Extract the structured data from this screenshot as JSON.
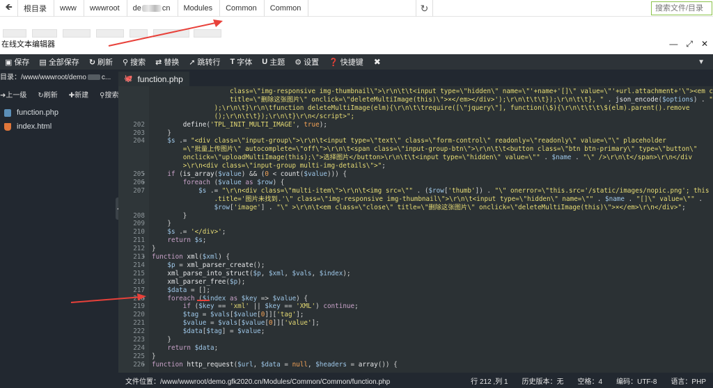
{
  "addressbar": {
    "crumbs": [
      "根目录",
      "www",
      "wwwroot",
      "de",
      "cn",
      "Modules",
      "Common",
      "Common"
    ],
    "search_placeholder": "搜索文件/目录"
  },
  "window": {
    "title": "在线文本编辑器"
  },
  "toolbar": {
    "items": [
      {
        "icon": "save-icon",
        "label": "保存"
      },
      {
        "icon": "save-all-icon",
        "label": "全部保存"
      },
      {
        "icon": "refresh-icon",
        "label": "刷新"
      },
      {
        "icon": "search-icon",
        "label": "搜索"
      },
      {
        "icon": "replace-icon",
        "label": "替换"
      },
      {
        "icon": "goto-line-icon",
        "label": "跳转行"
      },
      {
        "icon": "font-icon",
        "label": "字体"
      },
      {
        "icon": "theme-icon",
        "label": "主题"
      },
      {
        "icon": "gear-icon",
        "label": "设置"
      },
      {
        "icon": "help-icon",
        "label": "快捷键"
      }
    ]
  },
  "sidebar": {
    "path": "目录：/www/wwwroot/demo",
    "path_suffix": "c...",
    "actions": [
      "上一级",
      "刷新",
      "新建",
      "搜索"
    ],
    "files": [
      {
        "name": "function.php",
        "type": "php"
      },
      {
        "name": "index.html",
        "type": "html"
      }
    ]
  },
  "tab": {
    "name": "function.php"
  },
  "code": {
    "lines": [
      {
        "n": "",
        "fold": "",
        "html": "&nbsp;&nbsp;&nbsp;&nbsp;&nbsp;&nbsp;&nbsp;&nbsp;&nbsp;&nbsp;&nbsp;&nbsp;&nbsp;&nbsp;&nbsp;&nbsp;&nbsp;&nbsp;&nbsp;&nbsp;<span class=\"st\">class=\\\"img-responsive img-thumbnail\\\"&gt;\\r\\n\\t\\t&lt;input type=\\\"hidden\\\" name=\\\"'+name+'[]\\\" value=\\\"'+url.attachment+'\\\"&gt;&lt;em class=\\\"close\\\"</span>"
      },
      {
        "n": "",
        "fold": "",
        "html": "&nbsp;&nbsp;&nbsp;&nbsp;&nbsp;&nbsp;&nbsp;&nbsp;&nbsp;&nbsp;&nbsp;&nbsp;&nbsp;&nbsp;&nbsp;&nbsp;&nbsp;&nbsp;&nbsp;&nbsp;<span class=\"st\">title=\\\"删除这张图片\\\" onclick=\\\"deleteMultiImage(this)\\\"&gt;×&lt;/em&gt;&lt;/div&gt;');\\r\\n\\t\\t\\t});\\r\\n\\t\\t}, \"</span> . <span class=\"fn\">json_encode</span>(<span class=\"va\">$options</span>) . <span class=\"st\">\"</span>"
      },
      {
        "n": "",
        "fold": "",
        "html": "&nbsp;&nbsp;&nbsp;&nbsp;&nbsp;&nbsp;&nbsp;&nbsp;&nbsp;&nbsp;&nbsp;&nbsp;&nbsp;&nbsp;&nbsp;&nbsp;<span class=\"st\">);\\r\\n\\t}\\r\\n\\tfunction deleteMultiImage(elm){\\r\\n\\t\\trequire([\\\"jquery\\\"], function(\\$){\\r\\n\\t\\t\\t\\$(elm).parent().remove</span>"
      },
      {
        "n": "",
        "fold": "",
        "html": "&nbsp;&nbsp;&nbsp;&nbsp;&nbsp;&nbsp;&nbsp;&nbsp;&nbsp;&nbsp;&nbsp;&nbsp;&nbsp;&nbsp;&nbsp;&nbsp;<span class=\"st\">();\\r\\n\\t\\t});\\r\\n\\t}\\r\\n&lt;/script&gt;\";</span>"
      },
      {
        "n": "202",
        "fold": "",
        "html": "&nbsp;&nbsp;&nbsp;&nbsp;&nbsp;&nbsp;&nbsp;&nbsp;<span class=\"fn\">define</span>(<span class=\"st\">'TPL_INIT_MULTI_IMAGE'</span>, <span class=\"bi\">true</span>);"
      },
      {
        "n": "203",
        "fold": "",
        "html": "&nbsp;&nbsp;&nbsp;&nbsp;}"
      },
      {
        "n": "204",
        "fold": "",
        "html": "&nbsp;&nbsp;&nbsp;&nbsp;<span class=\"va\">$s</span> .= <span class=\"st\">\"&lt;div class=\\\"input-group\\\"&gt;\\r\\n\\t&lt;input type=\\\"text\\\" class=\\\"form-control\\\" readonly=\\\"readonly\\\" value=\\\"\\\" placeholder</span>"
      },
      {
        "n": "",
        "fold": "",
        "html": "&nbsp;&nbsp;&nbsp;&nbsp;&nbsp;&nbsp;&nbsp;&nbsp;<span class=\"st\">=\\\"批量上传图片\\\" autocomplete=\\\"off\\\"&gt;\\r\\n\\t&lt;span class=\\\"input-group-btn\\\"&gt;\\r\\n\\t\\t&lt;button class=\\\"btn btn-primary\\\" type=\\\"button\\\"</span>"
      },
      {
        "n": "",
        "fold": "",
        "html": "&nbsp;&nbsp;&nbsp;&nbsp;&nbsp;&nbsp;&nbsp;&nbsp;<span class=\"st\">onclick=\\\"uploadMultiImage(this);\\\"&gt;选择图片&lt;/button&gt;\\r\\n\\t\\t&lt;input type=\\\"hidden\\\" value=\\\"\"</span> . <span class=\"va\">$name</span> . <span class=\"st\">\"\\\" /&gt;\\r\\n\\t&lt;/span&gt;\\r\\n&lt;/div</span>"
      },
      {
        "n": "",
        "fold": "",
        "html": "&nbsp;&nbsp;&nbsp;&nbsp;&nbsp;&nbsp;&nbsp;&nbsp;<span class=\"st\">&gt;\\r\\n&lt;div class=\\\"input-group multi-img-details\\\"&gt;\"</span>;"
      },
      {
        "n": "205",
        "fold": "▾",
        "html": "&nbsp;&nbsp;&nbsp;&nbsp;<span class=\"kw\">if</span> (<span class=\"fn\">is_array</span>(<span class=\"va\">$value</span>) &amp;&amp; (<span class=\"bi\">0</span> &lt; <span class=\"fn\">count</span>(<span class=\"va\">$value</span>))) {"
      },
      {
        "n": "206",
        "fold": "▾",
        "html": "&nbsp;&nbsp;&nbsp;&nbsp;&nbsp;&nbsp;&nbsp;&nbsp;<span class=\"kw\">foreach</span> (<span class=\"va\">$value</span> <span class=\"kw\">as</span> <span class=\"va\">$row</span>) {"
      },
      {
        "n": "207",
        "fold": "",
        "html": "&nbsp;&nbsp;&nbsp;&nbsp;&nbsp;&nbsp;&nbsp;&nbsp;&nbsp;&nbsp;&nbsp;&nbsp;<span class=\"va\">$s</span> .= <span class=\"st\">\"\\r\\n&lt;div class=\\\"multi-item\\\"&gt;\\r\\n\\t&lt;img src=\\\"\"</span> . (<span class=\"va\">$row</span>[<span class=\"st\">'thumb'</span>]) . <span class=\"st\">\"\\\" onerror=\\\"this.src='/static/images/nopic.png'; this</span>"
      },
      {
        "n": "",
        "fold": "",
        "html": "&nbsp;&nbsp;&nbsp;&nbsp;&nbsp;&nbsp;&nbsp;&nbsp;&nbsp;&nbsp;&nbsp;&nbsp;&nbsp;&nbsp;&nbsp;&nbsp;<span class=\"st\">.title='图片未找到.'\\\" class=\\\"img-responsive img-thumbnail\\\"&gt;\\r\\n\\t&lt;input type=\\\"hidden\\\" name=\\\"\"</span> . <span class=\"va\">$name</span> . <span class=\"st\">\"[]\\\" value=\\\"\"</span> ."
      },
      {
        "n": "",
        "fold": "",
        "html": "&nbsp;&nbsp;&nbsp;&nbsp;&nbsp;&nbsp;&nbsp;&nbsp;&nbsp;&nbsp;&nbsp;&nbsp;&nbsp;&nbsp;&nbsp;&nbsp;<span class=\"va\">$row</span>[<span class=\"st\">'image'</span>] . <span class=\"st\">\"\\\" &gt;\\r\\n\\t&lt;em class=\\\"close\\\" title=\\\"删除这张图片\\\" onclick=\\\"deleteMultiImage(this)\\\"&gt;×&lt;/em&gt;\\r\\n&lt;/div&gt;\"</span>;"
      },
      {
        "n": "208",
        "fold": "",
        "html": "&nbsp;&nbsp;&nbsp;&nbsp;&nbsp;&nbsp;&nbsp;&nbsp;}"
      },
      {
        "n": "209",
        "fold": "",
        "html": "&nbsp;&nbsp;&nbsp;&nbsp;}"
      },
      {
        "n": "210",
        "fold": "",
        "html": "&nbsp;&nbsp;&nbsp;&nbsp;<span class=\"va\">$s</span> .= <span class=\"st\">'&lt;/div&gt;'</span>;"
      },
      {
        "n": "211",
        "fold": "",
        "html": "&nbsp;&nbsp;&nbsp;&nbsp;<span class=\"kw\">return</span> <span class=\"va\">$s</span>;"
      },
      {
        "n": "212",
        "fold": "",
        "html": "}"
      },
      {
        "n": "213",
        "fold": "▾",
        "html": "<span class=\"kw\">function</span> <span class=\"fn\">xml</span>(<span class=\"va\">$xml</span>) {"
      },
      {
        "n": "214",
        "fold": "",
        "html": "&nbsp;&nbsp;&nbsp;&nbsp;<span class=\"va\">$p</span> = <span class=\"fn\">xml_parser_create</span>();"
      },
      {
        "n": "215",
        "fold": "",
        "html": "&nbsp;&nbsp;&nbsp;&nbsp;<span class=\"fn\">xml_parse_into_struct</span>(<span class=\"va\">$p</span>, <span class=\"va\">$xml</span>, <span class=\"va\">$vals</span>, <span class=\"va\">$index</span>);"
      },
      {
        "n": "216",
        "fold": "",
        "html": "&nbsp;&nbsp;&nbsp;&nbsp;<span class=\"fn\">xml_parser_free</span>(<span class=\"va\">$p</span>);"
      },
      {
        "n": "217",
        "fold": "",
        "html": "&nbsp;&nbsp;&nbsp;&nbsp;<span class=\"va\">$data</span> = [];"
      },
      {
        "n": "218",
        "fold": "▾",
        "html": "&nbsp;&nbsp;&nbsp;&nbsp;<span class=\"kw\">foreach</span> (<span class=\"va\">$index</span> <span class=\"kw\">as</span> <span class=\"va\">$key</span> =&gt; <span class=\"va\">$value</span>) {"
      },
      {
        "n": "219",
        "fold": "",
        "html": "&nbsp;&nbsp;&nbsp;&nbsp;&nbsp;&nbsp;&nbsp;&nbsp;<span class=\"kw\">if</span> (<span class=\"va\">$key</span> == <span class=\"st\">'xml'</span> || <span class=\"va\">$key</span> == <span class=\"st\">'XML'</span>) <span class=\"kw\">continue</span>;"
      },
      {
        "n": "220",
        "fold": "",
        "html": "&nbsp;&nbsp;&nbsp;&nbsp;&nbsp;&nbsp;&nbsp;&nbsp;<span class=\"va\">$tag</span> = <span class=\"va\">$vals</span>[<span class=\"va\">$value</span>[<span class=\"bi\">0</span>]][<span class=\"st\">'tag'</span>];"
      },
      {
        "n": "221",
        "fold": "",
        "html": "&nbsp;&nbsp;&nbsp;&nbsp;&nbsp;&nbsp;&nbsp;&nbsp;<span class=\"va\">$value</span> = <span class=\"va\">$vals</span>[<span class=\"va\">$value</span>[<span class=\"bi\">0</span>]][<span class=\"st\">'value'</span>];"
      },
      {
        "n": "222",
        "fold": "",
        "html": "&nbsp;&nbsp;&nbsp;&nbsp;&nbsp;&nbsp;&nbsp;&nbsp;<span class=\"va\">$data</span>[<span class=\"va\">$tag</span>] = <span class=\"va\">$value</span>;"
      },
      {
        "n": "223",
        "fold": "",
        "html": "&nbsp;&nbsp;&nbsp;&nbsp;}"
      },
      {
        "n": "224",
        "fold": "",
        "html": "&nbsp;&nbsp;&nbsp;&nbsp;<span class=\"kw\">return</span> <span class=\"va\">$data</span>;"
      },
      {
        "n": "225",
        "fold": "",
        "html": "}"
      },
      {
        "n": "226",
        "fold": "▾",
        "html": "<span class=\"kw\">function</span> <span class=\"fn\">http_request</span>(<span class=\"va\">$url</span>, <span class=\"va\">$data</span> = <span class=\"bi\">null</span>, <span class=\"va\">$headers</span> = <span class=\"fn\">array</span>()) {"
      }
    ]
  },
  "status": {
    "file_location": "文件位置：/www/wwwroot/demo.gfk2020.cn/Modules/Common/Common/function.php",
    "cursor": "行 212 ,列 1",
    "history": "历史版本：无",
    "indent": "空格：4",
    "encoding": "编码：UTF-8",
    "language": "语言：PHP"
  },
  "colors": {
    "sidebar_bg": "#222830",
    "code_bg": "#2b3134",
    "annotation_arrow": "#e8413a"
  }
}
